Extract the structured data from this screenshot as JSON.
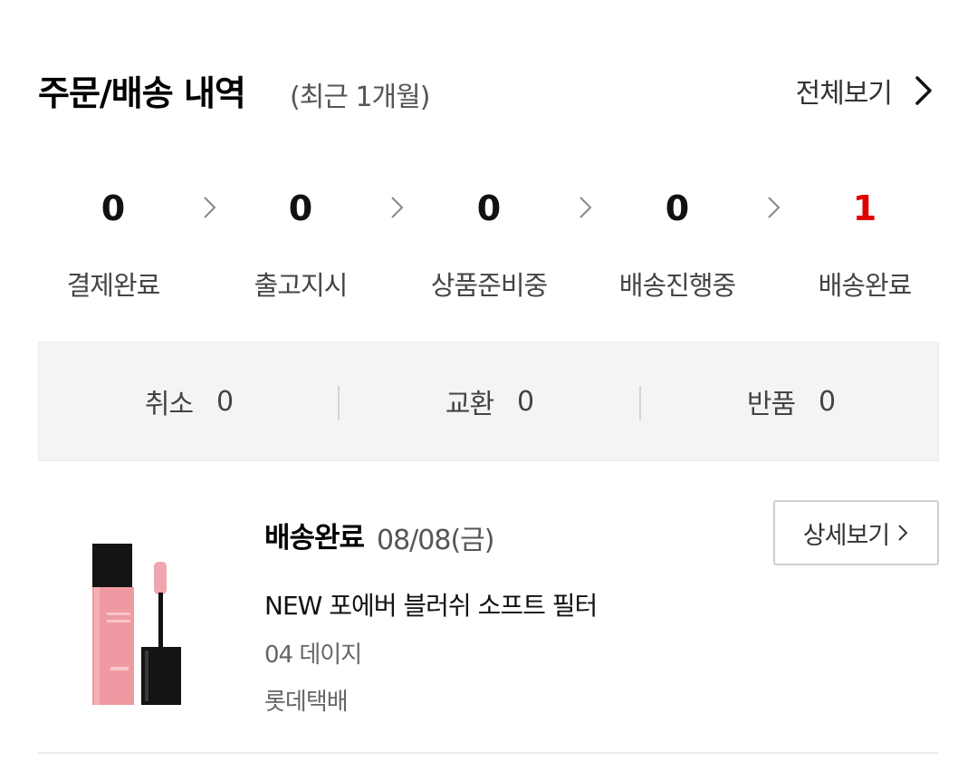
{
  "header": {
    "title": "주문/배송 내역",
    "subtitle": "(최근 1개월)",
    "view_all_label": "전체보기"
  },
  "steps": [
    {
      "count": "0",
      "label": "결제완료"
    },
    {
      "count": "0",
      "label": "출고지시"
    },
    {
      "count": "0",
      "label": "상품준비중"
    },
    {
      "count": "0",
      "label": "배송진행중"
    },
    {
      "count": "1",
      "label": "배송완료",
      "highlight_color": "#e00000"
    }
  ],
  "claims": [
    {
      "label": "취소",
      "count": "0"
    },
    {
      "label": "교환",
      "count": "0"
    },
    {
      "label": "반품",
      "count": "0"
    }
  ],
  "order": {
    "status": "배송완료",
    "date": "08/08(금)",
    "detail_button": "상세보기",
    "product_name": "NEW 포에버 블러쉬 소프트 필터",
    "option": "04 데이지",
    "courier": "롯데택배"
  },
  "colors": {
    "accent_red": "#e00000",
    "panel_bg": "#f4f4f4",
    "product_pink": "#ef9aa2"
  },
  "icons": {
    "view_all": "chevron-right-icon",
    "step_separator": "chevron-right-icon",
    "detail": "chevron-right-icon"
  }
}
